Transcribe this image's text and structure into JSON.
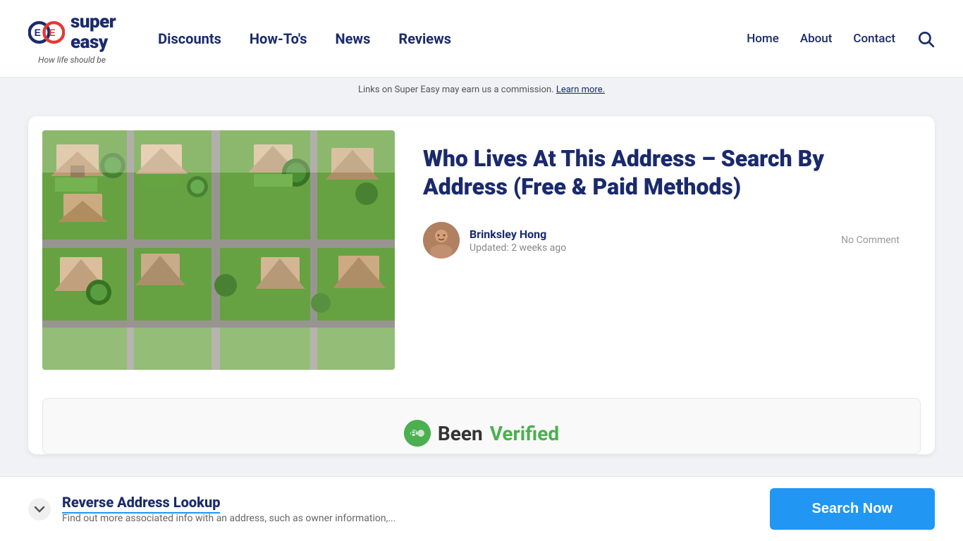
{
  "header": {
    "logo": {
      "brand_super": "super",
      "brand_easy": "easy",
      "tagline_pre": "How life ",
      "tagline_em": "should",
      "tagline_post": " be"
    },
    "nav": {
      "items": [
        {
          "label": "Discounts",
          "id": "discounts"
        },
        {
          "label": "How-To's",
          "id": "howtos"
        },
        {
          "label": "News",
          "id": "news"
        },
        {
          "label": "Reviews",
          "id": "reviews"
        }
      ]
    },
    "right_nav": {
      "items": [
        {
          "label": "Home",
          "id": "home"
        },
        {
          "label": "About",
          "id": "about"
        },
        {
          "label": "Contact",
          "id": "contact"
        }
      ]
    }
  },
  "commission_bar": {
    "text": "Links on Super Easy may earn us a commission. ",
    "link": "Learn more."
  },
  "article": {
    "title": "Who Lives At This Address – Search By Address (Free & Paid Methods)",
    "author_name": "Brinksley Hong",
    "updated": "Updated: 2 weeks ago",
    "no_comment": "No Comment"
  },
  "been_verified": {
    "logo_text_been": "Been",
    "logo_text_verified": "Verified"
  },
  "bottom_bar": {
    "title": "Reverse Address Lookup",
    "description": "Find out more associated info with an address, such as owner information,...",
    "search_button": "Search Now"
  }
}
